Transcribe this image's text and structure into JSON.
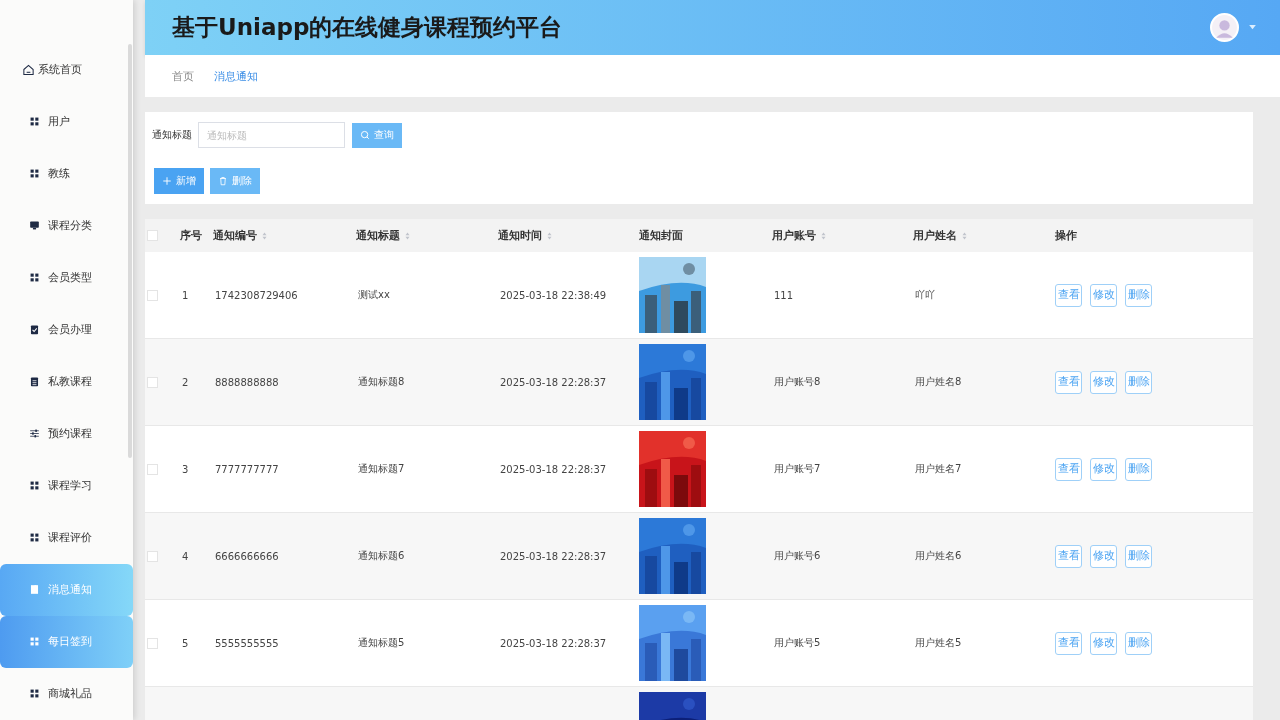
{
  "sidebar": {
    "items": [
      {
        "label": "系统首页",
        "kind": "home",
        "selected": false,
        "hovered": false
      },
      {
        "label": "用户",
        "kind": "grid",
        "selected": false,
        "hovered": false
      },
      {
        "label": "教练",
        "kind": "grid",
        "selected": false,
        "hovered": false
      },
      {
        "label": "课程分类",
        "kind": "monitor",
        "selected": false,
        "hovered": false
      },
      {
        "label": "会员类型",
        "kind": "grid",
        "selected": false,
        "hovered": false
      },
      {
        "label": "会员办理",
        "kind": "clipboard-check",
        "selected": false,
        "hovered": false
      },
      {
        "label": "私教课程",
        "kind": "clipboard",
        "selected": false,
        "hovered": false
      },
      {
        "label": "预约课程",
        "kind": "sliders",
        "selected": false,
        "hovered": false
      },
      {
        "label": "课程学习",
        "kind": "grid",
        "selected": false,
        "hovered": false
      },
      {
        "label": "课程评价",
        "kind": "grid",
        "selected": false,
        "hovered": false
      },
      {
        "label": "消息通知",
        "kind": "book",
        "selected": true,
        "hovered": false
      },
      {
        "label": "每日签到",
        "kind": "grid",
        "selected": false,
        "hovered": true
      },
      {
        "label": "商城礼品",
        "kind": "grid",
        "selected": false,
        "hovered": false
      }
    ]
  },
  "header": {
    "title": "基于Uniapp的在线健身课程预约平台"
  },
  "breadcrumb": [
    {
      "label": "首页",
      "selected": false
    },
    {
      "label": "消息通知",
      "selected": true
    }
  ],
  "search": {
    "label": "通知标题",
    "placeholder": "通知标题",
    "button": "查询"
  },
  "actions": [
    {
      "label": "新增",
      "kind": "add"
    },
    {
      "label": "删除",
      "kind": "delete"
    }
  ],
  "table": {
    "select_all": {
      "checked": false
    },
    "columns": [
      {
        "label": "序号",
        "sortable": false
      },
      {
        "label": "通知编号",
        "sortable": true
      },
      {
        "label": "通知标题",
        "sortable": true
      },
      {
        "label": "通知时间",
        "sortable": true
      },
      {
        "label": "通知封面",
        "sortable": false
      },
      {
        "label": "用户账号",
        "sortable": true
      },
      {
        "label": "用户姓名",
        "sortable": true
      },
      {
        "label": "操作",
        "sortable": false
      }
    ],
    "rows": [
      {
        "checked": false,
        "cells": [
          "1",
          "1742308729406",
          "测试xx",
          "2025-03-18 22:38:49",
          {
            "kind": "picture"
          },
          "111",
          "吖吖"
        ],
        "buttons": [
          "查看",
          "修改",
          "删除"
        ]
      },
      {
        "checked": false,
        "cells": [
          "2",
          "8888888888",
          "通知标题8",
          "2025-03-18 22:28:37",
          {
            "kind": "picture"
          },
          "用户账号8",
          "用户姓名8"
        ],
        "buttons": [
          "查看",
          "修改",
          "删除"
        ]
      },
      {
        "checked": false,
        "cells": [
          "3",
          "7777777777",
          "通知标题7",
          "2025-03-18 22:28:37",
          {
            "kind": "picture"
          },
          "用户账号7",
          "用户姓名7"
        ],
        "buttons": [
          "查看",
          "修改",
          "删除"
        ]
      },
      {
        "checked": false,
        "cells": [
          "4",
          "6666666666",
          "通知标题6",
          "2025-03-18 22:28:37",
          {
            "kind": "picture"
          },
          "用户账号6",
          "用户姓名6"
        ],
        "buttons": [
          "查看",
          "修改",
          "删除"
        ]
      },
      {
        "checked": false,
        "cells": [
          "5",
          "5555555555",
          "通知标题5",
          "2025-03-18 22:28:37",
          {
            "kind": "picture"
          },
          "用户账号5",
          "用户姓名5"
        ],
        "buttons": [
          "查看",
          "修改",
          "删除"
        ]
      },
      {
        "cells": [
          null,
          null,
          null,
          null,
          {
            "kind": "picture"
          }
        ],
        "buttons": []
      }
    ]
  }
}
